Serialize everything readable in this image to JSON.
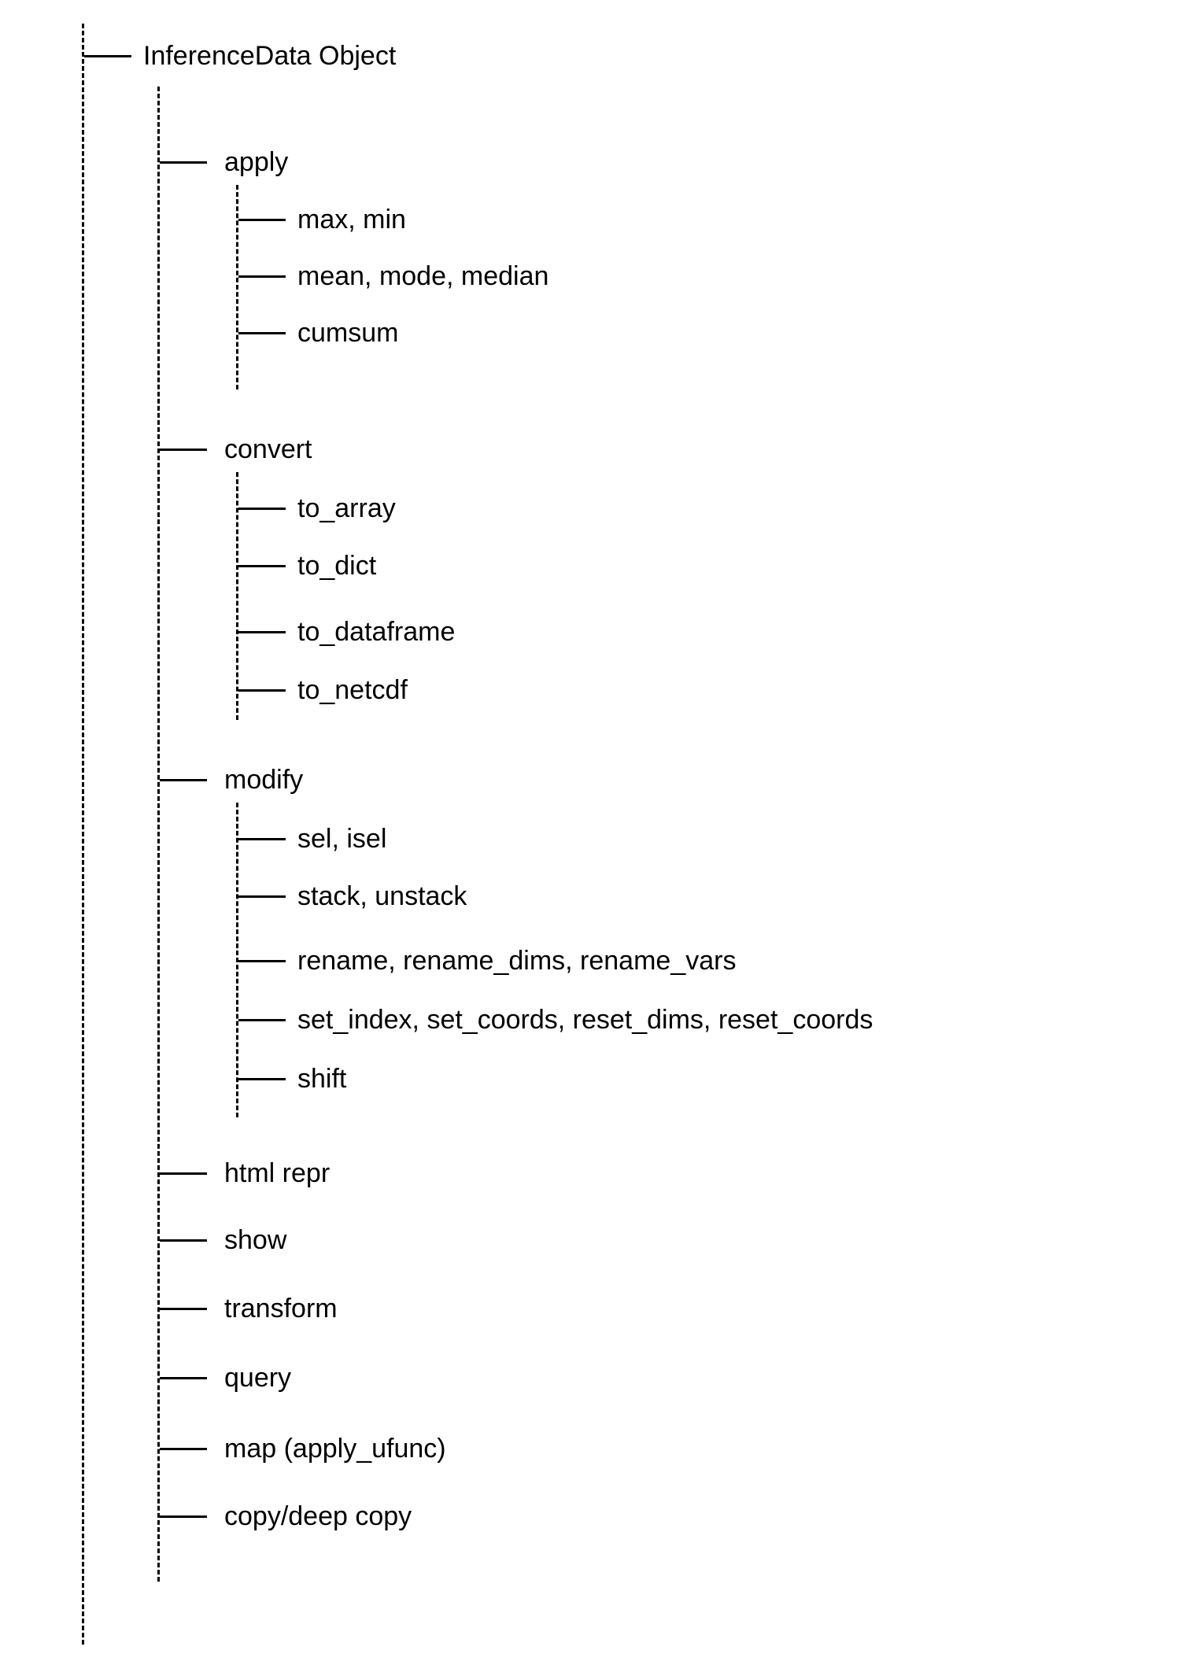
{
  "root": {
    "label": "InferenceData Object"
  },
  "level1": [
    {
      "key": "apply",
      "label": "apply",
      "children": [
        {
          "label": "max, min"
        },
        {
          "label": "mean, mode, median"
        },
        {
          "label": "cumsum"
        }
      ]
    },
    {
      "key": "convert",
      "label": "convert",
      "children": [
        {
          "label": "to_array"
        },
        {
          "label": "to_dict"
        },
        {
          "label": "to_dataframe"
        },
        {
          "label": "to_netcdf"
        }
      ]
    },
    {
      "key": "modify",
      "label": "modify",
      "children": [
        {
          "label": "sel, isel"
        },
        {
          "label": "stack, unstack"
        },
        {
          "label": "rename, rename_dims, rename_vars"
        },
        {
          "label": "set_index, set_coords, reset_dims, reset_coords"
        },
        {
          "label": "shift"
        }
      ]
    },
    {
      "key": "html_repr",
      "label": "html repr",
      "children": []
    },
    {
      "key": "show",
      "label": "show",
      "children": []
    },
    {
      "key": "transform",
      "label": "transform",
      "children": []
    },
    {
      "key": "query",
      "label": "query",
      "children": []
    },
    {
      "key": "map",
      "label": "map (apply_ufunc)",
      "children": []
    },
    {
      "key": "copy",
      "label": "copy/deep copy",
      "children": []
    }
  ]
}
